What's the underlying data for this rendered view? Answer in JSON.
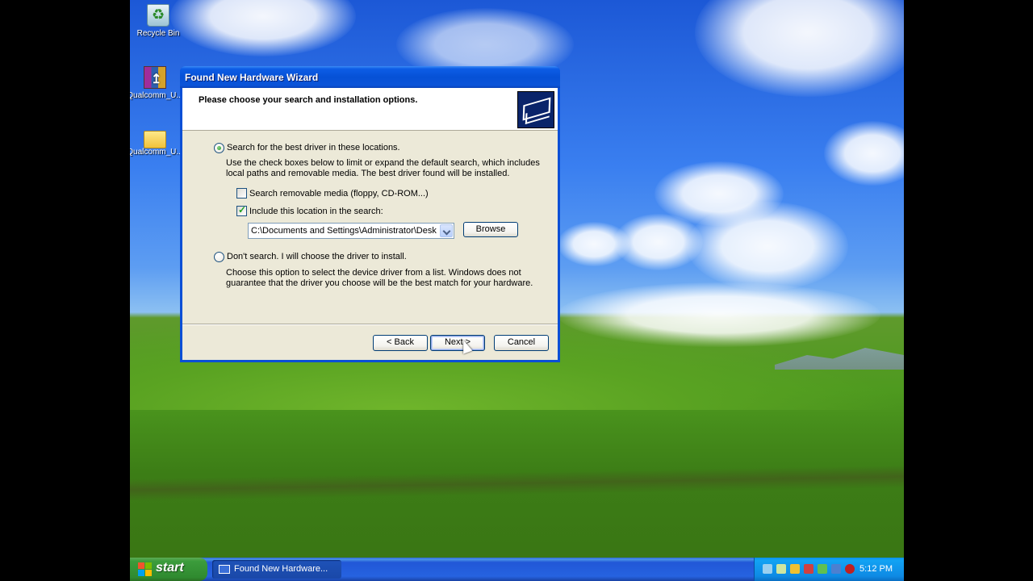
{
  "desktop": {
    "icons": [
      {
        "label": "Recycle Bin",
        "icon": "recycle-bin-icon"
      },
      {
        "label": "Qualcomm_U...",
        "icon": "winrar-archive-icon"
      },
      {
        "label": "Qualcomm_U...",
        "icon": "folder-icon"
      }
    ]
  },
  "wizard": {
    "title": "Found New Hardware Wizard",
    "heading": "Please choose your search and installation options.",
    "option_search": {
      "label": "Search for the best driver in these locations.",
      "selected": true,
      "description": "Use the check boxes below to limit or expand the default search, which includes local paths and removable media. The best driver found will be installed."
    },
    "checkbox_removable": {
      "label": "Search removable media (floppy, CD-ROM...)",
      "checked": false
    },
    "checkbox_location": {
      "label": "Include this location in the search:",
      "checked": true
    },
    "location_path": "C:\\Documents and Settings\\Administrator\\Desktop\\",
    "browse_label": "Browse",
    "option_manual": {
      "label": "Don't search. I will choose the driver to install.",
      "selected": false,
      "description": "Choose this option to select the device driver from a list.  Windows does not guarantee that the driver you choose will be the best match for your hardware."
    },
    "buttons": {
      "back": "< Back",
      "next": "Next >",
      "cancel": "Cancel"
    }
  },
  "taskbar": {
    "start_label": "start",
    "task_label": "Found New Hardware...",
    "clock": "5:12 PM"
  }
}
